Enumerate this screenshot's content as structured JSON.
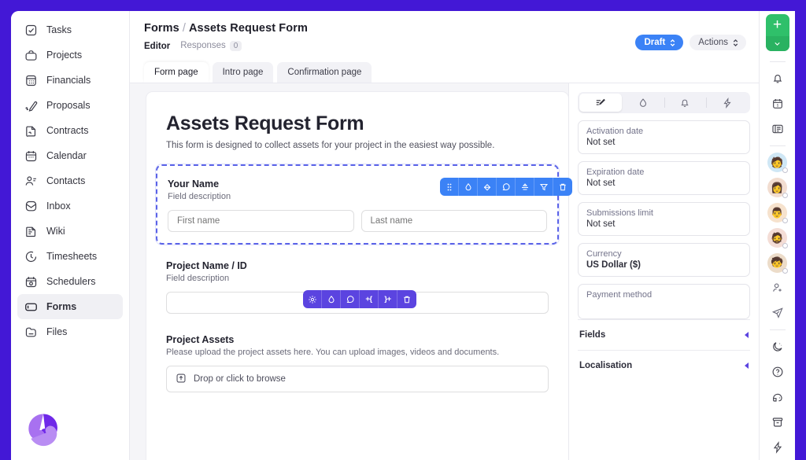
{
  "theme": {
    "frame": "#4318d6",
    "accent_blue": "#3b82f6",
    "accent_purple": "#5b44e0",
    "green": "#2fc06a"
  },
  "sidebar": {
    "items": [
      {
        "label": "Tasks",
        "icon": "checkbox-icon"
      },
      {
        "label": "Projects",
        "icon": "briefcase-icon"
      },
      {
        "label": "Financials",
        "icon": "calculator-icon"
      },
      {
        "label": "Proposals",
        "icon": "pen-icon"
      },
      {
        "label": "Contracts",
        "icon": "contract-icon"
      },
      {
        "label": "Calendar",
        "icon": "calendar-icon"
      },
      {
        "label": "Contacts",
        "icon": "people-icon"
      },
      {
        "label": "Inbox",
        "icon": "inbox-icon"
      },
      {
        "label": "Wiki",
        "icon": "book-icon"
      },
      {
        "label": "Timesheets",
        "icon": "clock-icon"
      },
      {
        "label": "Schedulers",
        "icon": "scheduler-icon"
      },
      {
        "label": "Forms",
        "icon": "form-icon",
        "active": true
      },
      {
        "label": "Files",
        "icon": "folder-icon"
      }
    ],
    "logo": "app-logo"
  },
  "header": {
    "breadcrumb_root": "Forms",
    "breadcrumb_sep": "/",
    "breadcrumb_current": "Assets Request Form",
    "subtabs": [
      {
        "label": "Editor",
        "active": true
      },
      {
        "label": "Responses",
        "count": "0",
        "active": false
      }
    ],
    "status_badge": "Draft",
    "actions_button": "Actions"
  },
  "page_tabs": [
    {
      "label": "Form page",
      "active": true
    },
    {
      "label": "Intro page",
      "active": false
    },
    {
      "label": "Confirmation page",
      "active": false
    }
  ],
  "form": {
    "title": "Assets Request Form",
    "subtitle": "This form is designed to collect assets for your project in the easiest way possible.",
    "fields": [
      {
        "label": "Your Name",
        "description": "Field description",
        "selected": true,
        "inputs": [
          {
            "placeholder": "First name",
            "value": ""
          },
          {
            "placeholder": "Last name",
            "value": ""
          }
        ]
      },
      {
        "label": "Project Name / ID",
        "description": "Field description",
        "selected": false,
        "inputs": [
          {
            "placeholder": "",
            "value": ""
          }
        ]
      },
      {
        "label": "Project Assets",
        "description": "Please upload the project assets here. You can upload images, videos and documents.",
        "selected": false,
        "dropzone": "Drop or click to browse"
      }
    ]
  },
  "toolbars": {
    "form_toolbar": {
      "color": "#3b82f6",
      "buttons": [
        {
          "icon": "drag-handle-icon"
        },
        {
          "icon": "droplet-icon"
        },
        {
          "icon": "paint-bucket-icon"
        },
        {
          "icon": "comment-icon"
        },
        {
          "icon": "upload-person-icon"
        },
        {
          "icon": "funnel-icon"
        },
        {
          "icon": "trash-icon"
        }
      ]
    },
    "field_toolbar": {
      "color": "#5b44e0",
      "buttons": [
        {
          "icon": "gear-icon"
        },
        {
          "icon": "droplet-icon"
        },
        {
          "icon": "comment-icon"
        },
        {
          "icon": "insert-before-icon",
          "text": "+{"
        },
        {
          "icon": "insert-after-icon",
          "text": "}+"
        },
        {
          "icon": "trash-icon"
        }
      ]
    }
  },
  "right_panel": {
    "tabs": [
      {
        "icon": "settings-pen-icon",
        "active": true
      },
      {
        "icon": "droplet-icon",
        "active": false
      },
      {
        "icon": "bell-icon",
        "active": false
      },
      {
        "icon": "lightning-icon",
        "active": false
      }
    ],
    "properties": [
      {
        "key": "Activation date",
        "value": "Not set",
        "strong": false
      },
      {
        "key": "Expiration date",
        "value": "Not set",
        "strong": false
      },
      {
        "key": "Submissions limit",
        "value": "Not set",
        "strong": false
      },
      {
        "key": "Currency",
        "value": "US Dollar ($)",
        "strong": true
      },
      {
        "key": "Payment method",
        "value": "",
        "strong": false
      }
    ],
    "sections": [
      {
        "title": "Fields",
        "collapsed": true
      },
      {
        "title": "Localisation",
        "collapsed": true
      }
    ]
  },
  "right_rail": {
    "add_button": "+",
    "add_dropdown": "chevron-down-icon",
    "top_icons": [
      {
        "icon": "bell-icon"
      },
      {
        "icon": "calendar-icon"
      },
      {
        "icon": "news-icon"
      }
    ],
    "avatars": [
      {
        "name": "avatar-1",
        "glyph": "🧑",
        "bg": "#cfe7f5"
      },
      {
        "name": "avatar-2",
        "glyph": "👩",
        "bg": "#f2ddd0"
      },
      {
        "name": "avatar-3",
        "glyph": "👨",
        "bg": "#f6e2cd"
      },
      {
        "name": "avatar-4",
        "glyph": "🧔",
        "bg": "#f4ddd6"
      },
      {
        "name": "avatar-5",
        "glyph": "🧒",
        "bg": "#ecdcc9"
      }
    ],
    "bottom_icons": [
      {
        "icon": "add-person-icon"
      },
      {
        "icon": "paper-plane-icon"
      },
      {
        "icon": "moon-icon"
      },
      {
        "icon": "help-icon"
      },
      {
        "icon": "support-icon"
      },
      {
        "icon": "archive-icon"
      },
      {
        "icon": "lightning-icon"
      }
    ]
  }
}
